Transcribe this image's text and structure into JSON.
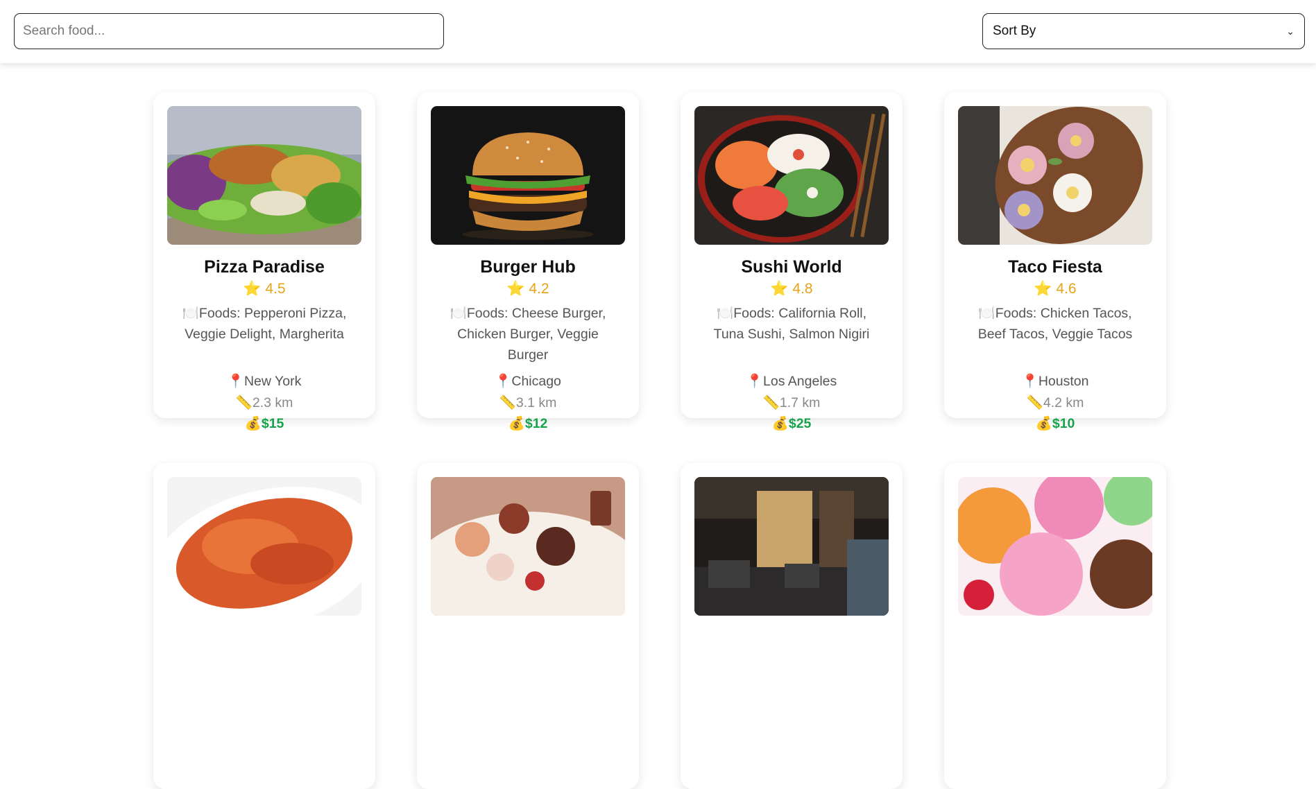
{
  "header": {
    "search_placeholder": "Search food...",
    "sort_label": "Sort By"
  },
  "icons": {
    "star": "⭐",
    "plate": "🍽️",
    "pin": "📍",
    "ruler": "📏",
    "money": "💰"
  },
  "cards": [
    {
      "name": "Pizza Paradise",
      "rating": "4.5",
      "foods": "Foods: Pepperoni Pizza, Veggie Delight, Margherita",
      "location": "New York",
      "distance": "2.3 km",
      "price": "$15",
      "image": "salad-bowl-photo"
    },
    {
      "name": "Burger Hub",
      "rating": "4.2",
      "foods": "Foods: Cheese Burger, Chicken Burger, Veggie Burger",
      "location": "Chicago",
      "distance": "3.1 km",
      "price": "$12",
      "image": "burger-photo"
    },
    {
      "name": "Sushi World",
      "rating": "4.8",
      "foods": "Foods: California Roll, Tuna Sushi, Salmon Nigiri",
      "location": "Los Angeles",
      "distance": "1.7 km",
      "price": "$25",
      "image": "sushi-platter-photo"
    },
    {
      "name": "Taco Fiesta",
      "rating": "4.6",
      "foods": "Foods: Chicken Tacos, Beef Tacos, Veggie Tacos",
      "location": "Houston",
      "distance": "4.2 km",
      "price": "$10",
      "image": "flower-sweets-photo"
    },
    {
      "image": "pasta-photo"
    },
    {
      "image": "dessert-platter-photo"
    },
    {
      "image": "restaurant-interior-photo"
    },
    {
      "image": "ice-cream-photo"
    }
  ]
}
